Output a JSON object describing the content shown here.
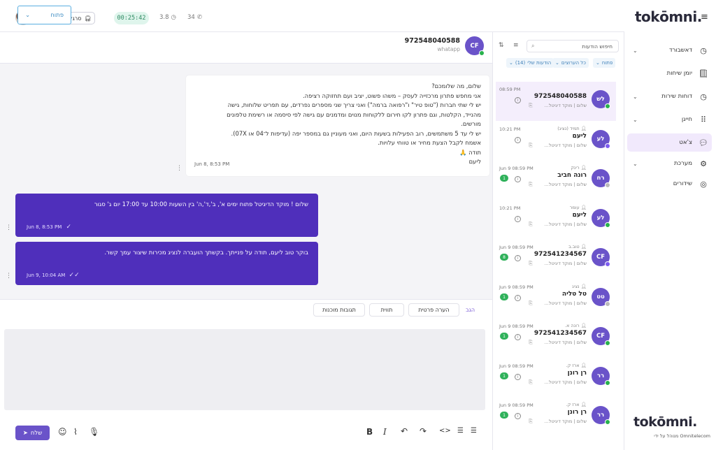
{
  "topbar": {
    "random_agent_label": "סרגל נציג",
    "timer": "00:25:42",
    "avg_time": "3.8",
    "calls": "34"
  },
  "chat": {
    "contact_name": "972548040588",
    "contact_channel": "whatapp",
    "contact_initials": "CF",
    "status_label": "פתוח",
    "incoming": {
      "lines": [
        "שלום, מה שלומכם?",
        "אני מחפש פתרון מרכזייה לעסק – משהו פשוט, יציב ועם תחזוקה רציפה.",
        "יש לי שתי חברות (\"טופ טיר\" ו\"רפואה ברמה\") ואני צריך שני מספרים נפרדים, עם תפריט שלוחות, גישה",
        "מהנייד, הקלטות, וגם פתרון לקו חירום ללקוחות מנוים ומדמנים עם גישה לפי סיסמה או רשימת טלפונים",
        "מורשים.",
        "יש לי עד 5 משתמשים, רוב הפעילות בשעות היום, ואני מעוניין גם במספר יפה (עדיפות ל־04 או 07X).",
        "אשמח לקבל הצעת מחיר או טווחי עלויות.",
        "תודה 🙏",
        "ליעם"
      ],
      "time": "Jun 8, 8:53 PM"
    },
    "outgoing": [
      {
        "text": "שלום ! מוקד הדיגיטל פתוח ימים א', ב',ד',ה' בין השעות 10:00 עד 17:00 יום ג' סגור",
        "time": "Jun 8, 8:53 PM"
      },
      {
        "text": "בוקר טוב ליעם, תודה על פנייתך. בקשתך הועברה לנציג מכירות שיצור עמך קשר.",
        "time": "Jun 9, 10:04 AM"
      }
    ]
  },
  "composer": {
    "tabs": {
      "reply": "הגב",
      "private_note": "הערה פרטית",
      "tags": "תווית",
      "canned": "תגובות מוכנות"
    },
    "send_label": "שלח"
  },
  "convlist": {
    "search_placeholder": "חיפוש הודעות",
    "filters": {
      "status": "פתוח",
      "all_types": "כל הערוצים",
      "my_msgs": "הודעות שלי",
      "my_count": "(14)"
    },
    "items": [
      {
        "time": "08:59 PM",
        "agent": "",
        "name": "972548040588",
        "preview": "שלום | מוקד דיגיטל...",
        "initials": "לש",
        "badge": "wa",
        "count": "",
        "selected": true
      },
      {
        "time": "10:21 PM",
        "agent": "תמיד (נציג)",
        "name": "ליעם",
        "preview": "שלום | מוקד דיגיטל...",
        "initials": "לע",
        "badge": "msgr",
        "count": ""
      },
      {
        "time": "Jun 9 08:59 PM",
        "agent": "רינק",
        "name": "רונה חביב",
        "preview": "שלום | מוקד דיגיטל...",
        "initials": "רח",
        "badge": "grey",
        "count": "1"
      },
      {
        "time": "10:21 PM",
        "agent": "עומר",
        "name": "ליעם",
        "preview": "שלום | מוקד דיגיטל...",
        "initials": "לע",
        "badge": "wa",
        "count": ""
      },
      {
        "time": "Jun 9 08:59 PM",
        "agent": "טוב.ב",
        "name": "972541234567",
        "preview": "שלום | מוקד דיגיטל...",
        "initials": "CF",
        "badge": "msgr",
        "count": "8"
      },
      {
        "time": "Jun 9 08:59 PM",
        "agent": "נציג",
        "name": "טל טליה",
        "preview": "שלום | מוקד דיגיטל...",
        "initials": "טט",
        "badge": "grey",
        "count": "1"
      },
      {
        "time": "Jun 9 08:59 PM",
        "agent": "רונה א.",
        "name": "972541234567",
        "preview": "שלום | מוקד דיגיטל...",
        "initials": "CF",
        "badge": "wa",
        "count": "1"
      },
      {
        "time": "Jun 9 08:59 PM",
        "agent": "ארז ק.",
        "name": "רן רונן",
        "preview": "שלום | מוקד דיגיטל...",
        "initials": "רר",
        "badge": "wa",
        "count": "1"
      },
      {
        "time": "Jun 9 08:59 PM",
        "agent": "ארז ק.",
        "name": "רן רונן",
        "preview": "שלום | מוקד דיגיטל...",
        "initials": "רר",
        "badge": "wa",
        "count": "1"
      }
    ]
  },
  "sidebar": {
    "logo": "tokōmni.",
    "footer_logo": "tokōmni.",
    "footer_sub": "Omnitelecom מנוהל על ידי",
    "items": [
      {
        "label": "דאשבורד",
        "icon": "clock-icon",
        "chevron": true
      },
      {
        "label": "יומן שיחות",
        "icon": "phone-book-icon",
        "chevron": false
      },
      {
        "label": "דוחות שירות",
        "icon": "report-icon",
        "chevron": true
      },
      {
        "label": "חייגן",
        "icon": "dialpad-icon",
        "chevron": true
      },
      {
        "label": "צ'אט",
        "icon": "chat-icon",
        "chevron": false,
        "active": true
      },
      {
        "label": "מערכת",
        "icon": "gear-icon",
        "chevron": true
      },
      {
        "label": "שידורים",
        "icon": "broadcast-icon",
        "chevron": false
      }
    ]
  },
  "colors": {
    "accent": "#4f2fbb",
    "avatar": "#6a53c9",
    "whatsapp": "#28b14c",
    "active_nav": "#f1e9fc"
  }
}
